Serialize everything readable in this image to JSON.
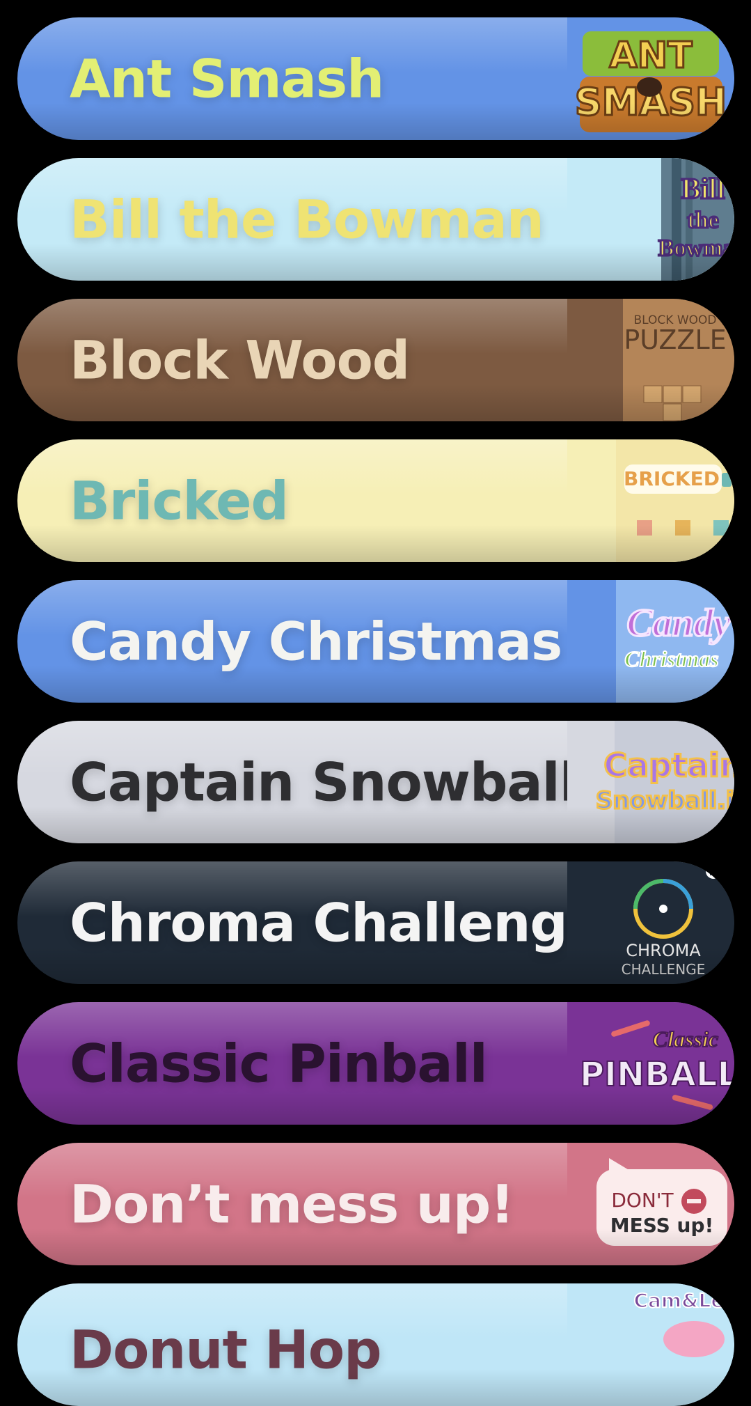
{
  "games": [
    {
      "title": "Ant Smash",
      "bg": "#6393e6",
      "fg": "#e3ef74",
      "art_lines": [
        "ANT",
        "SMASH"
      ]
    },
    {
      "title": "Bill the Bowman",
      "bg": "#c4eaf7",
      "fg": "#efe373",
      "art_lines": [
        "Bill",
        "the",
        "Bowman"
      ]
    },
    {
      "title": "Block Wood",
      "bg": "#7d5a41",
      "fg": "#e9d5b6",
      "art_lines": [
        "BLOCK WOOD",
        "PUZZLE"
      ]
    },
    {
      "title": "Bricked",
      "bg": "#f6efb6",
      "fg": "#6eb8b3",
      "art_lines": [
        "BRICKED"
      ]
    },
    {
      "title": "Candy Christmas",
      "bg": "#6393e6",
      "fg": "#f4f4f0",
      "art_lines": [
        "Candy",
        "Christmas"
      ]
    },
    {
      "title": "Captain Snowball",
      "bg": "#d6d8e0",
      "fg": "#2e2e31",
      "art_lines": [
        "Captain",
        "Snowball.io"
      ]
    },
    {
      "title": "Chroma Challenge",
      "bg": "#1f2a37",
      "fg": "#f4f4f4",
      "art_lines": [
        "CHROMA",
        "CHALLENGE"
      ]
    },
    {
      "title": "Classic Pinball",
      "bg": "#7a3396",
      "fg": "#2a1230",
      "art_lines": [
        "Classic",
        "PINBALL"
      ]
    },
    {
      "title": "Don’t mess up!",
      "bg": "#d27588",
      "fg": "#f8ecec",
      "art_lines": [
        "DON'T",
        "MESS up!"
      ]
    },
    {
      "title": "Donut Hop",
      "bg": "#bfe6f7",
      "fg": "#6a3b4a",
      "art_lines": [
        "Cam&Leon"
      ]
    }
  ]
}
